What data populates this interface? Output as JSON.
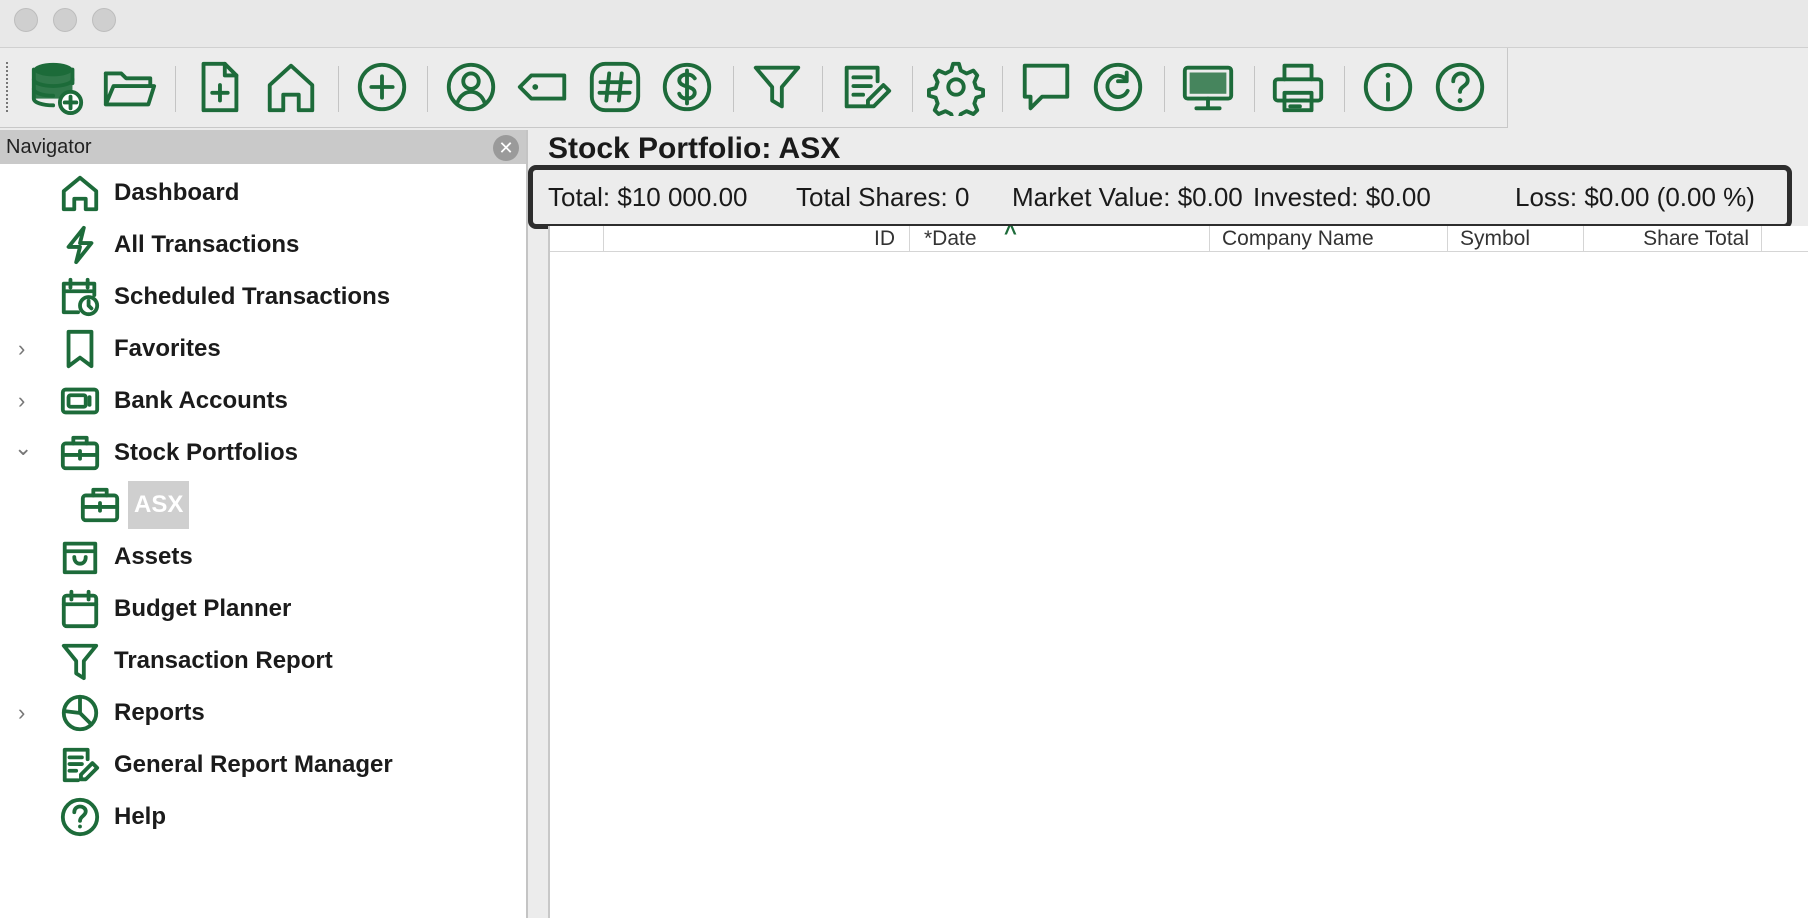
{
  "navigator": {
    "title": "Navigator",
    "close_symbol": "✕",
    "items": [
      {
        "label": "Dashboard",
        "icon": "home-icon"
      },
      {
        "label": "All Transactions",
        "icon": "lightning-icon"
      },
      {
        "label": "Scheduled Transactions",
        "icon": "calendar-clock-icon"
      },
      {
        "label": "Favorites",
        "icon": "bookmark-icon",
        "expander": "collapsed"
      },
      {
        "label": "Bank Accounts",
        "icon": "bank-card-icon",
        "expander": "collapsed"
      },
      {
        "label": "Stock Portfolios",
        "icon": "briefcase-icon",
        "expander": "expanded"
      },
      {
        "label": "Assets",
        "icon": "shopping-bag-icon"
      },
      {
        "label": "Budget Planner",
        "icon": "calendar-icon"
      },
      {
        "label": "Transaction Report",
        "icon": "filter-icon"
      },
      {
        "label": "Reports",
        "icon": "pie-chart-icon",
        "expander": "collapsed"
      },
      {
        "label": "General Report Manager",
        "icon": "report-edit-icon"
      },
      {
        "label": "Help",
        "icon": "help-icon"
      }
    ],
    "subitem": {
      "label": "ASX",
      "icon": "briefcase-icon"
    },
    "chevron_collapsed": "›",
    "chevron_expanded": "⌄"
  },
  "toolbar": {
    "buttons": [
      "new-database-icon",
      "open-folder-icon",
      "new-transaction-icon",
      "home-icon",
      "add-icon",
      "user-icon",
      "tag-icon",
      "hash-icon",
      "dollar-icon",
      "filter-icon",
      "report-edit-icon",
      "gear-icon",
      "chat-icon",
      "refresh-icon",
      "monitor-icon",
      "printer-icon",
      "info-icon",
      "help-icon"
    ]
  },
  "main": {
    "title": "Stock Portfolio: ASX",
    "summary": {
      "total": "Total: $10 000.00",
      "total_shares": "Total Shares: 0",
      "market_value": "Market Value: $0.00",
      "invested": "Invested: $0.00",
      "loss": "Loss: $0.00 (0.00 %)"
    },
    "columns": [
      "ID",
      "*Date",
      "Company Name",
      "Symbol",
      "Share Total"
    ],
    "sort_indicator": "^"
  },
  "colors": {
    "accent": "#1d6b3a",
    "highlight_box": "#2d2d2d"
  }
}
